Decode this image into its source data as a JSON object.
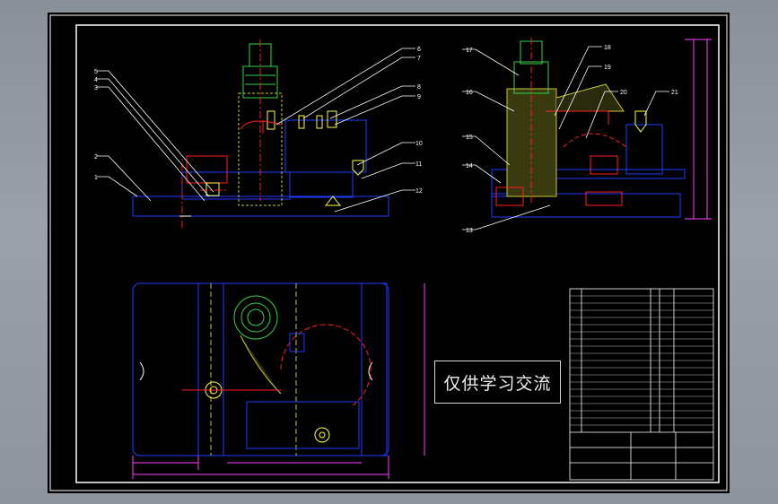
{
  "watermark": {
    "text": "仅供学习交流"
  },
  "part_balloons": [
    "1",
    "2",
    "3",
    "4",
    "5",
    "6",
    "7",
    "8",
    "9",
    "10",
    "11",
    "12",
    "13",
    "14",
    "15",
    "16",
    "17",
    "18",
    "19",
    "20",
    "21"
  ],
  "colors": {
    "background": "#000000",
    "outer_frame": "#ffffff",
    "outline": "#1f3cff",
    "center_line": "#ff2020",
    "cylinder": "#35d24a",
    "hatch": "#c8c832",
    "dimension": "#ff40ff",
    "leader": "#ffffff"
  },
  "icons": {
    "part_balloon": "balloon-leader-icon",
    "fastener": "bolt-icon"
  }
}
